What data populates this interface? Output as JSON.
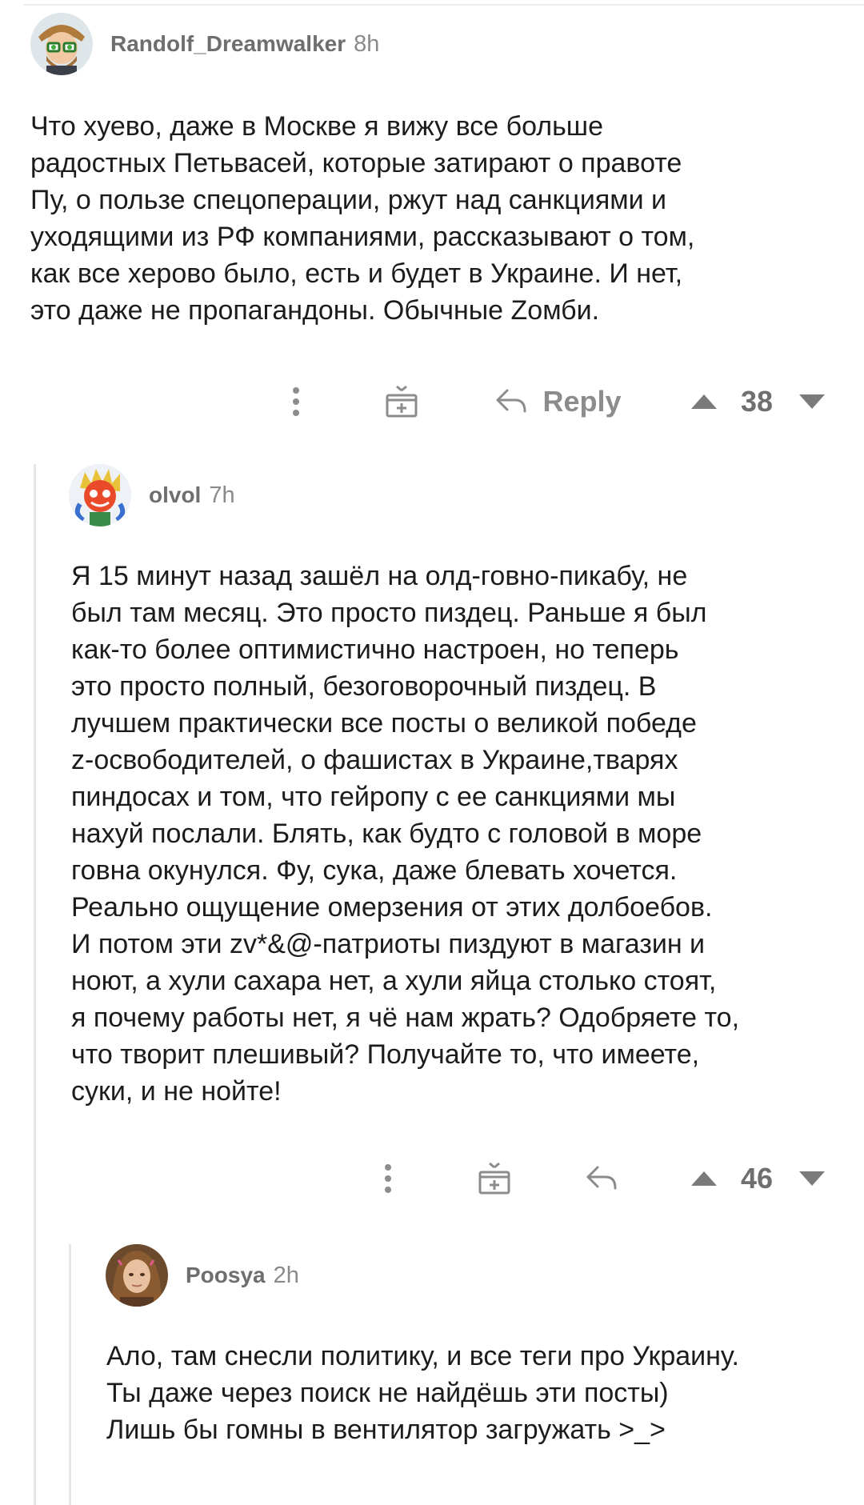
{
  "comments": [
    {
      "username": "Randolf_Dreamwalker",
      "time": "8h",
      "body": "Что хуево, даже в Москве я вижу все больше\nрадостных Петьвасей, которые затирают о правоте\nПу, о пользе спецоперации, ржут над санкциями и\nуходящими из РФ компаниями, рассказывают о том,\nкак все херово было, есть и будет в Украине. И нет,\nэто даже не пропагандоны. Обычные Zомби.",
      "reply_label": "Reply",
      "score": "38"
    },
    {
      "username": "olvol",
      "time": "7h",
      "body": "Я 15 минут назад зашёл на олд-говно-пикабу, не\nбыл там месяц. Это просто пиздец. Раньше я был\nкак-то более оптимистично настроен, но теперь\nэто просто полный, безоговорочный пиздец. В\nлучшем практически все посты о великой победе\nz-освободителей, о фашистах в Украине,тварях\nпиндосах и том, что гейропу с ее санкциями мы\nнахуй послали. Блять, как будто с головой в море\nговна окунулся. Фу, сука, даже блевать хочется.\nРеально ощущение омерзения от этих долбоебов.\nИ потом эти zv*&@-патриоты пиздуют в магазин и\nноют, а хули сахара нет, а хули яйца столько стоят,\nя почему работы нет, я чё нам жрать? Одобряете то,\nчто творит плешивый? Получайте то, что имеете,\nсуки, и не нойте!",
      "score": "46"
    },
    {
      "username": "Poosya",
      "time": "2h",
      "body": "Ало, там снесли политику, и все теги про Украину.\nТы даже через поиск не найдёшь эти посты)\nЛишь бы гомны в вентилятор загружать  >_>"
    }
  ],
  "icons": {
    "more": "more-vertical-icon",
    "gift": "gift-icon",
    "reply": "reply-arrow-icon",
    "upvote": "upvote-icon",
    "downvote": "downvote-icon"
  },
  "colors": {
    "text": "#1c1c1c",
    "meta": "#8a8a8a",
    "icon": "#8c8c8c",
    "thread_line": "#e6e6e6"
  }
}
